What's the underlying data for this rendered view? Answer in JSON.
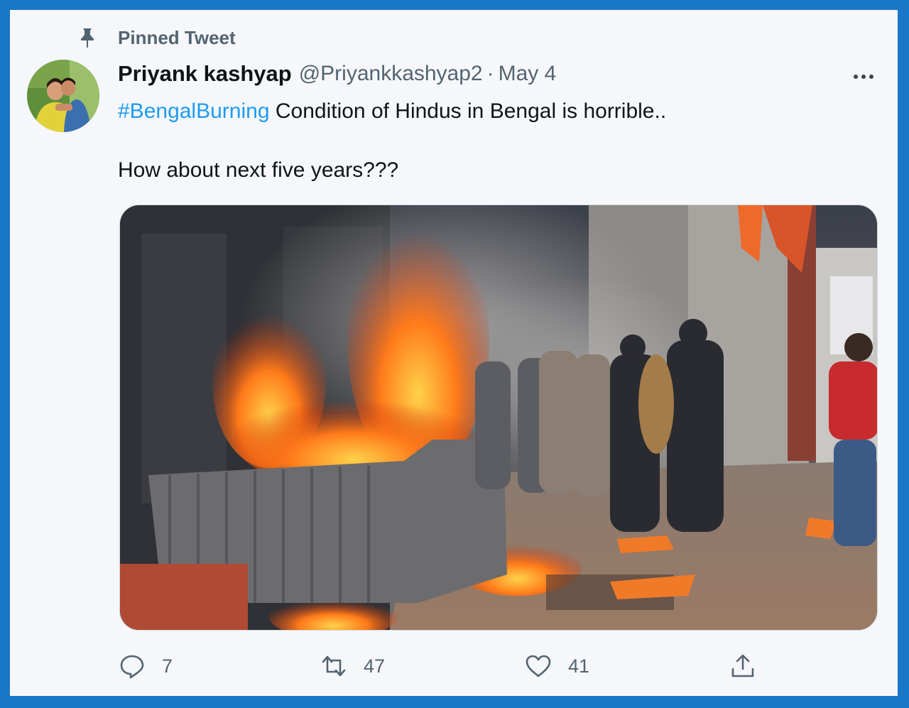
{
  "pinned": {
    "label": "Pinned Tweet",
    "icon": "pin-icon"
  },
  "tweet": {
    "author_name": "Priyank kashyap",
    "handle": "@Priyankkashyap2",
    "separator": "·",
    "date": "May 4",
    "hashtag": "#BengalBurning",
    "text_line1": " Condition of Hindus in Bengal is horrible..",
    "text_line2": "How about next five years???"
  },
  "actions": {
    "reply": {
      "icon": "reply-icon",
      "count": "7"
    },
    "retweet": {
      "icon": "retweet-icon",
      "count": "47"
    },
    "like": {
      "icon": "heart-icon",
      "count": "41"
    },
    "share": {
      "icon": "share-icon"
    }
  },
  "colors": {
    "link": "#1d9bf0",
    "muted": "#536471",
    "frame_border": "#1877c9",
    "background": "#f6f7fa"
  }
}
